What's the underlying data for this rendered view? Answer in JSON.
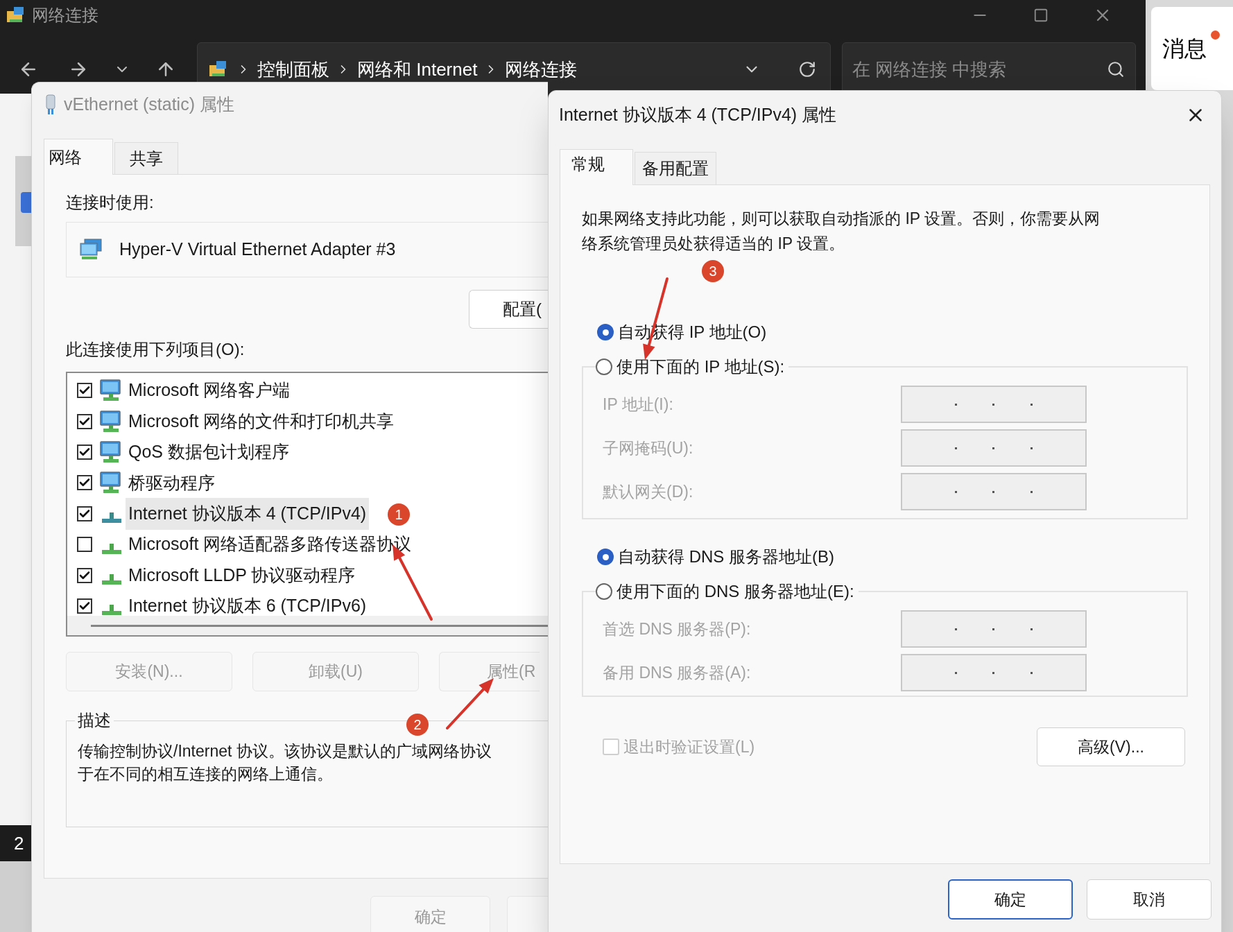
{
  "explorer": {
    "title": "网络连接",
    "breadcrumbs": [
      "控制面板",
      "网络和 Internet",
      "网络连接"
    ],
    "search": {
      "placeholder": "在 网络连接 中搜索"
    },
    "side_badge": "2"
  },
  "notification": {
    "label": "消息",
    "unread": true
  },
  "adapter_dialog": {
    "title": "vEthernet (static) 属性",
    "tabs": [
      {
        "label": "网络",
        "selected": true
      },
      {
        "label": "共享",
        "selected": false
      }
    ],
    "connect_using_label": "连接时使用:",
    "adapter": "Hyper-V Virtual Ethernet Adapter #3",
    "configure_button": "配置(",
    "items_label": "此连接使用下列项目(O):",
    "items": [
      {
        "label": "Microsoft 网络客户端",
        "checked": true,
        "selected": false,
        "kind": "service"
      },
      {
        "label": "Microsoft 网络的文件和打印机共享",
        "checked": true,
        "selected": false,
        "kind": "service"
      },
      {
        "label": "QoS 数据包计划程序",
        "checked": true,
        "selected": false,
        "kind": "service"
      },
      {
        "label": "桥驱动程序",
        "checked": true,
        "selected": false,
        "kind": "service"
      },
      {
        "label": "Internet 协议版本 4 (TCP/IPv4)",
        "checked": true,
        "selected": true,
        "kind": "protocol"
      },
      {
        "label": "Microsoft 网络适配器多路传送器协议",
        "checked": false,
        "selected": false,
        "kind": "protocol"
      },
      {
        "label": "Microsoft LLDP 协议驱动程序",
        "checked": true,
        "selected": false,
        "kind": "protocol"
      },
      {
        "label": "Internet 协议版本 6 (TCP/IPv6)",
        "checked": true,
        "selected": false,
        "kind": "protocol"
      }
    ],
    "buttons": [
      {
        "label": "安装(N)...",
        "disabled": true
      },
      {
        "label": "卸载(U)",
        "disabled": true
      },
      {
        "label": "属性(R",
        "disabled": true
      }
    ],
    "description": {
      "title": "描述",
      "lines": [
        "传输控制协议/Internet 协议。该协议是默认的广域网络协议",
        "于在不同的相互连接的网络上通信。"
      ]
    },
    "footer_buttons": [
      {
        "label": "确定",
        "disabled": true
      }
    ]
  },
  "ipv4_dialog": {
    "title": "Internet 协议版本 4 (TCP/IPv4) 属性",
    "tabs": [
      {
        "label": "常规",
        "selected": true
      },
      {
        "label": "备用配置",
        "selected": false
      }
    ],
    "intro_lines": [
      "如果网络支持此功能，则可以获取自动指派的 IP 设置。否则，你需要从网",
      "络系统管理员处获得适当的 IP 设置。"
    ],
    "ip_options": [
      {
        "label": "自动获得 IP 地址(O)",
        "selected": true
      },
      {
        "label": "使用下面的 IP 地址(S):",
        "selected": false
      }
    ],
    "ip_fields": [
      {
        "label": "IP 地址(I):",
        "disabled": true
      },
      {
        "label": "子网掩码(U):",
        "disabled": true
      },
      {
        "label": "默认网关(D):",
        "disabled": true
      }
    ],
    "dns_options": [
      {
        "label": "自动获得 DNS 服务器地址(B)",
        "selected": true
      },
      {
        "label": "使用下面的 DNS 服务器地址(E):",
        "selected": false
      }
    ],
    "dns_fields": [
      {
        "label": "首选 DNS 服务器(P):",
        "disabled": true
      },
      {
        "label": "备用 DNS 服务器(A):",
        "disabled": true
      }
    ],
    "validate": {
      "label": "退出时验证设置(L)",
      "checked": false,
      "disabled": true
    },
    "advanced_button": "高级(V)...",
    "buttons": [
      {
        "label": "确定",
        "default": true
      },
      {
        "label": "取消",
        "default": false
      }
    ]
  },
  "annotations": [
    {
      "label": "1"
    },
    {
      "label": "2"
    },
    {
      "label": "3"
    }
  ]
}
